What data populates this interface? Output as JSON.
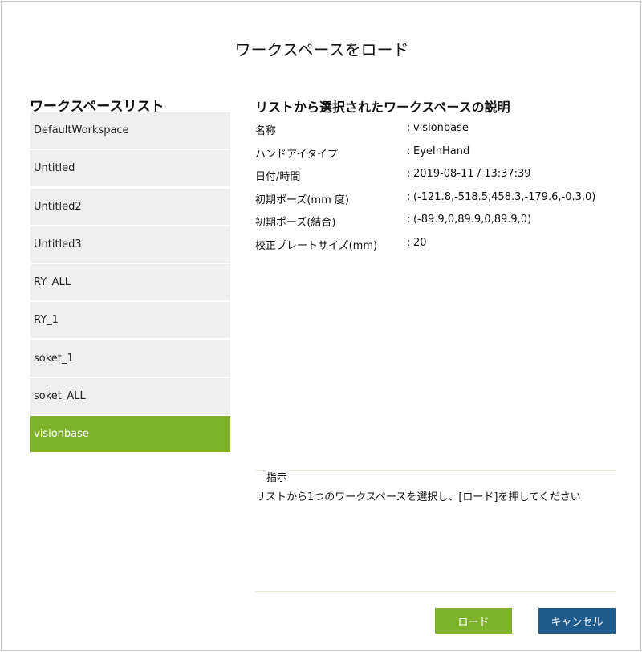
{
  "dialog": {
    "title": "ワークスペースをロード"
  },
  "workspace_list": {
    "heading": "ワークスペースリスト",
    "items": [
      {
        "label": "DefaultWorkspace",
        "selected": false
      },
      {
        "label": "Untitled",
        "selected": false
      },
      {
        "label": "Untitled2",
        "selected": false
      },
      {
        "label": "Untitled3",
        "selected": false
      },
      {
        "label": "RY_ALL",
        "selected": false
      },
      {
        "label": "RY_1",
        "selected": false
      },
      {
        "label": "soket_1",
        "selected": false
      },
      {
        "label": "soket_ALL",
        "selected": false
      },
      {
        "label": "visionbase",
        "selected": true
      }
    ]
  },
  "description": {
    "heading": "リストから選択されたワークスペースの説明",
    "separator": ":",
    "rows": [
      {
        "key": "名称",
        "value": "visionbase"
      },
      {
        "key": "ハンドアイタイプ",
        "value": "EyeInHand"
      },
      {
        "key": "日付/時間",
        "value": "2019-08-11 / 13:37:39"
      },
      {
        "key": "初期ポーズ(mm 度)",
        "value": "(-121.8,-518.5,458.3,-179.6,-0.3,0)"
      },
      {
        "key": "初期ポーズ(結合)",
        "value": "(-89.9,0,89.9,0,89.9,0)"
      },
      {
        "key": "校正プレートサイズ(mm)",
        "value": "20"
      }
    ]
  },
  "hint": {
    "label": "指示",
    "text": "リストから1つのワークスペースを選択し、[ロード]を押してください"
  },
  "buttons": {
    "load_label": "ロード",
    "cancel_label": "キャンセル"
  },
  "colors": {
    "accent_green": "#7fb22b",
    "cancel_blue": "#1f5a8c",
    "list_item_bg": "#efefef"
  }
}
